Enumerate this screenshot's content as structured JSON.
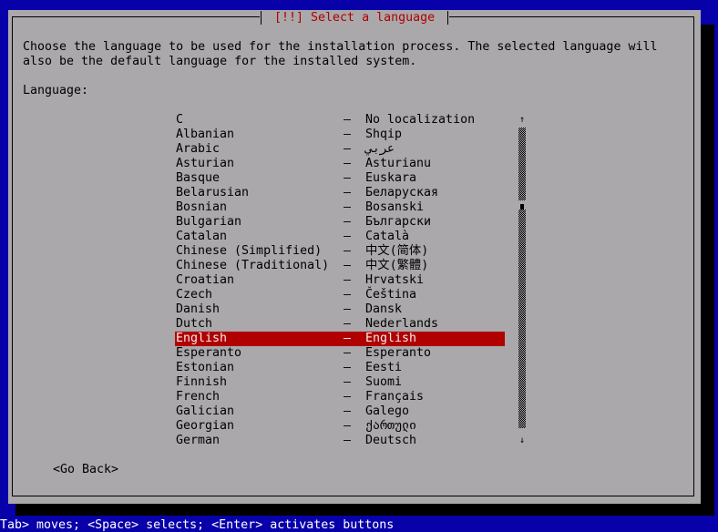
{
  "dialog": {
    "title": "[!!] Select a language",
    "description_line1": "Choose the language to be used for the installation process. The selected language will",
    "description_line2": "also be the default language for the installed system.",
    "list_label": "Language:"
  },
  "languages": [
    {
      "name": "C",
      "native": "No localization"
    },
    {
      "name": "Albanian",
      "native": "Shqip"
    },
    {
      "name": "Arabic",
      "native": "عربي"
    },
    {
      "name": "Asturian",
      "native": "Asturianu"
    },
    {
      "name": "Basque",
      "native": "Euskara"
    },
    {
      "name": "Belarusian",
      "native": "Беларуская"
    },
    {
      "name": "Bosnian",
      "native": "Bosanski"
    },
    {
      "name": "Bulgarian",
      "native": "Български"
    },
    {
      "name": "Catalan",
      "native": "Català"
    },
    {
      "name": "Chinese (Simplified)",
      "native": "中文(简体)"
    },
    {
      "name": "Chinese (Traditional)",
      "native": "中文(繁體)"
    },
    {
      "name": "Croatian",
      "native": "Hrvatski"
    },
    {
      "name": "Czech",
      "native": "Čeština"
    },
    {
      "name": "Danish",
      "native": "Dansk"
    },
    {
      "name": "Dutch",
      "native": "Nederlands"
    },
    {
      "name": "English",
      "native": "English",
      "selected": true
    },
    {
      "name": "Esperanto",
      "native": "Esperanto"
    },
    {
      "name": "Estonian",
      "native": "Eesti"
    },
    {
      "name": "Finnish",
      "native": "Suomi"
    },
    {
      "name": "French",
      "native": "Français"
    },
    {
      "name": "Galician",
      "native": "Galego"
    },
    {
      "name": "Georgian",
      "native": "ქართული"
    },
    {
      "name": "German",
      "native": "Deutsch"
    }
  ],
  "separator": "–",
  "scrollbar": {
    "up_arrow": "↑",
    "down_arrow": "↓"
  },
  "buttons": {
    "go_back": "<Go Back>"
  },
  "status_bar": "Tab> moves; <Space> selects; <Enter> activates buttons",
  "colors": {
    "background": "#0800a8",
    "dialog": "#aaa8aa",
    "title": "#b00000",
    "selection": "#b00000"
  }
}
